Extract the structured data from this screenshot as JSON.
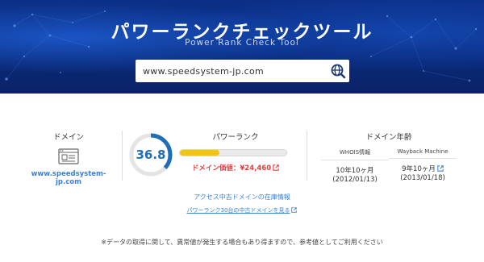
{
  "hero": {
    "title": "パワーランクチェックツール",
    "subtitle": "Power Rank Check Tool"
  },
  "search": {
    "value": "www.speedsystem-jp.com",
    "button_icon": "globe-search-icon"
  },
  "domain": {
    "label": "ドメイン",
    "icon": "website-icon",
    "link_text": "www.speedsystem-jp.com"
  },
  "power_rank": {
    "label": "パワーランク",
    "score": "36.8",
    "score_fraction": 0.368,
    "bar_fraction": 0.37,
    "price_text": "ドメイン価値：¥24,460",
    "price_icon": "external-link-icon"
  },
  "domain_age": {
    "label": "ドメイン年齢",
    "whois": {
      "header": "WHOIS情報",
      "age": "10年10ヶ月",
      "date": "(2012/01/13)"
    },
    "wayback": {
      "header": "Wayback Machine",
      "age": "9年10ヶ月",
      "date": "(2013/01/18)",
      "icon": "external-link-icon"
    }
  },
  "links": {
    "inventory": "アクセス中古ドメインの在庫情報",
    "power30": "パワーランク30台の中古ドメインを見る"
  },
  "note": "※データの取得に関して、異常値が発生する場合もあり得ますので、参考値としてご利用ください",
  "colors": {
    "hero_bg": "#0b2f86",
    "accent_blue": "#3b82d6",
    "gauge_blue": "#1f6fb8",
    "bar_yellow": "#f0c21a",
    "price_red": "#e04040"
  }
}
